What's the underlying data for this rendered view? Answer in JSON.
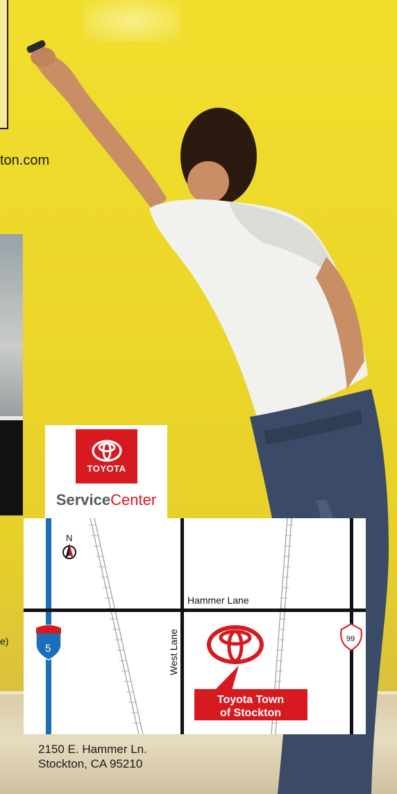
{
  "colors": {
    "toyota_red": "#d71920",
    "wall_yellow": "#ecd72a",
    "interstate_blue": "#1a6fb8",
    "service_gray": "#555a5e"
  },
  "header": {
    "url_fragment": "ton.com"
  },
  "side_text": {
    "paren_fragment": "e)"
  },
  "service_logo": {
    "brand_word": "TOYOTA",
    "service_word": "Service",
    "center_word": "Center",
    "icon": "toyota-emblem-icon"
  },
  "map": {
    "north_label": "N",
    "roads": {
      "hammer_lane": "Hammer Lane",
      "west_lane": "West Lane"
    },
    "interstate_shield": "5",
    "highway_shield": "99",
    "dealer_label_line1": "Toyota Town",
    "dealer_label_line2": "of Stockton",
    "icons": [
      "north-arrow-icon",
      "interstate-shield-icon",
      "highway-shield-icon",
      "toyota-emblem-icon",
      "railroad-track-icon"
    ]
  },
  "address": {
    "line1": "2150 E. Hammer Ln.",
    "line2": "Stockton, CA 95210"
  }
}
